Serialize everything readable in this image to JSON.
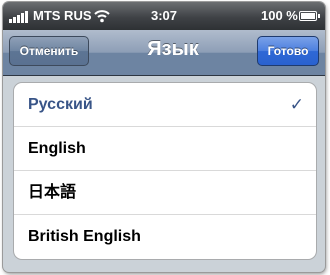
{
  "status_bar": {
    "carrier": "MTS RUS",
    "time": "3:07",
    "battery_percent": "100 %",
    "icons": [
      "signal-strength-icon",
      "wifi-icon",
      "battery-icon"
    ]
  },
  "nav_bar": {
    "title": "Язык",
    "cancel_label": "Отменить",
    "done_label": "Готово"
  },
  "languages": [
    {
      "label": "Русский",
      "selected": true
    },
    {
      "label": "English",
      "selected": false
    },
    {
      "label": "日本語",
      "selected": false
    },
    {
      "label": "British English",
      "selected": false
    }
  ],
  "checkmark_glyph": "✓",
  "colors": {
    "selected_text": "#385487",
    "done_button": "#2f68d6",
    "nav_bar": "#6d84a2"
  }
}
